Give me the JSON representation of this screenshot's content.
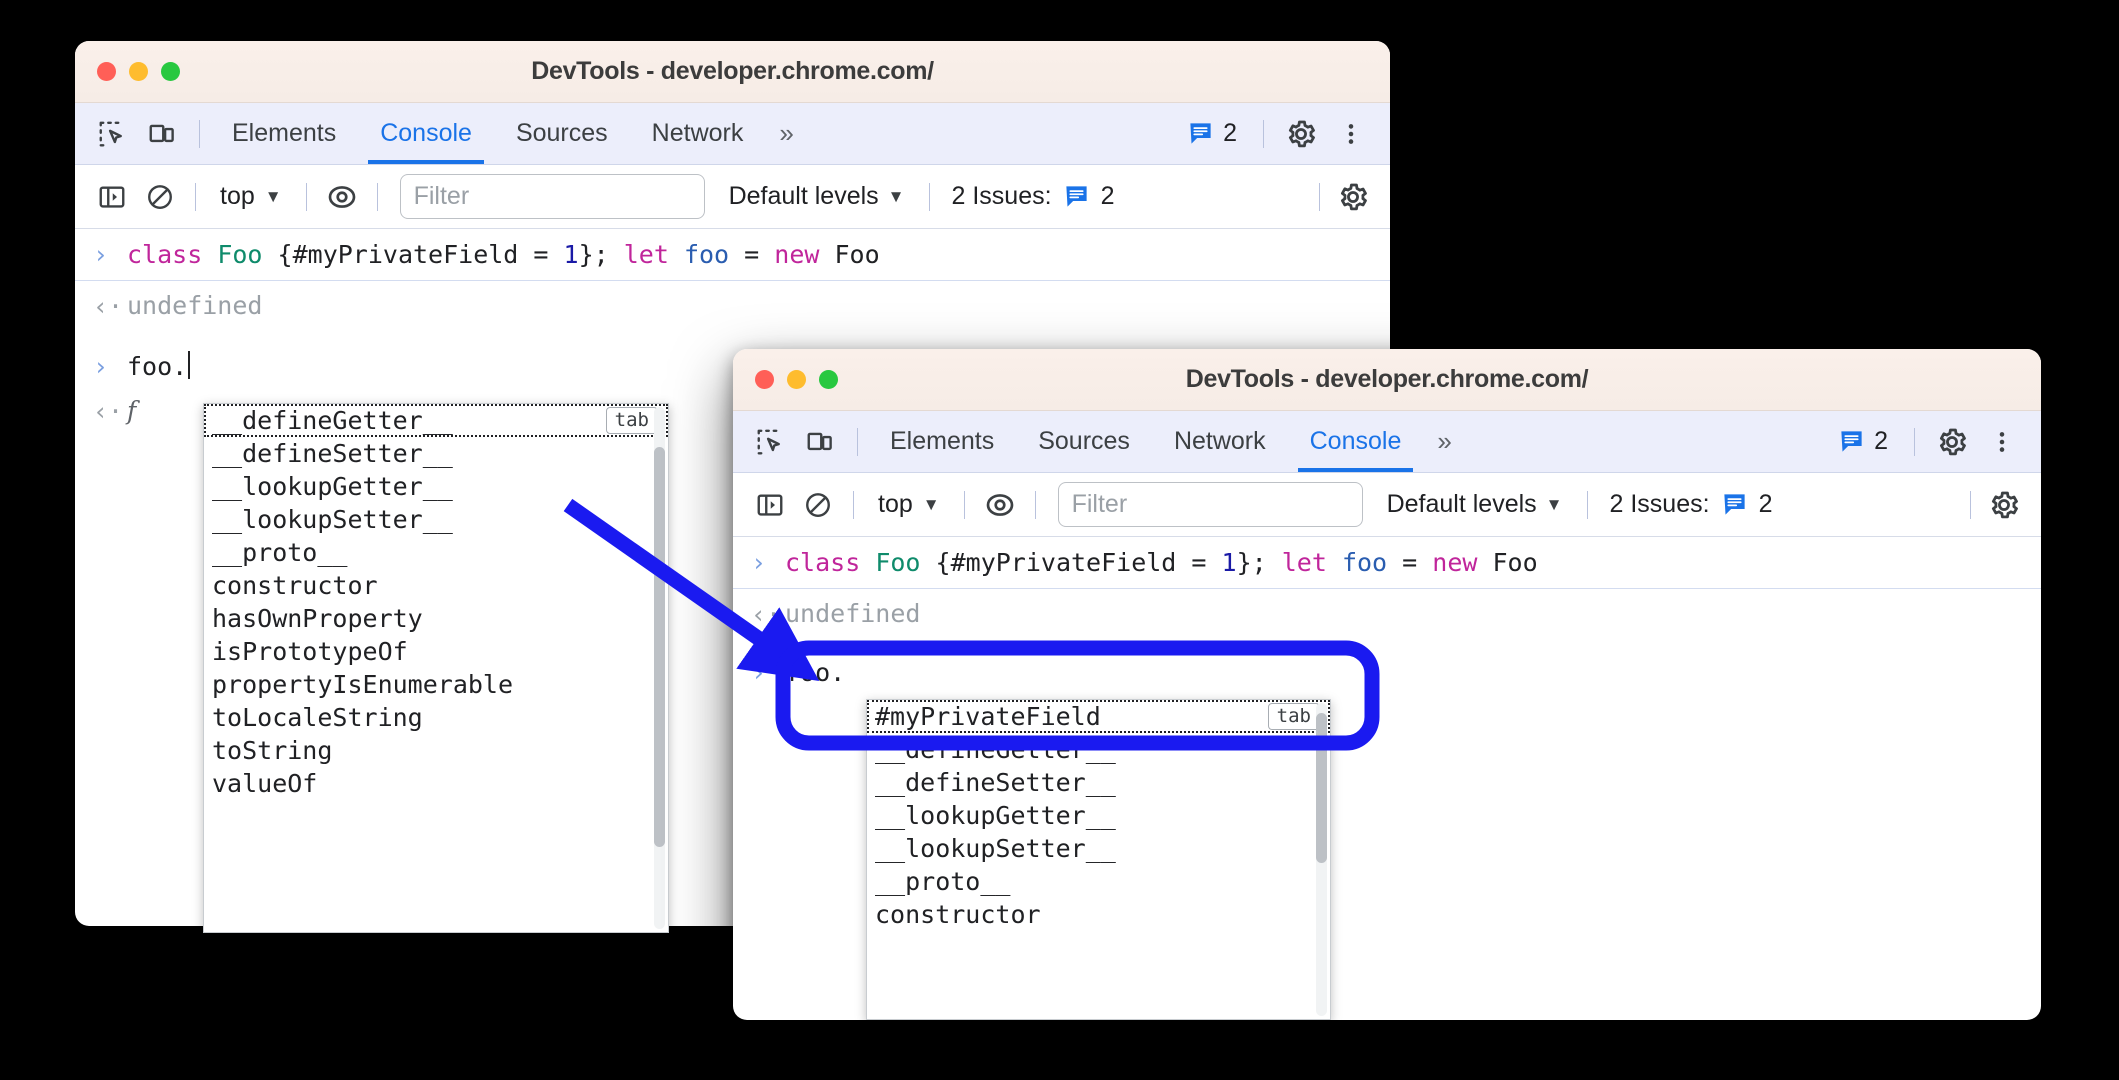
{
  "windows": [
    {
      "id": "back",
      "title": "DevTools - developer.chrome.com/",
      "traffic": [
        "close-red",
        "minimize-yellow",
        "zoom-green"
      ],
      "tabs": [
        {
          "label": "Elements",
          "active": false
        },
        {
          "label": "Console",
          "active": true
        },
        {
          "label": "Sources",
          "active": false
        },
        {
          "label": "Network",
          "active": false
        }
      ],
      "more_tabs_glyph": "»",
      "issues_badge_count": "2",
      "toolbar": {
        "context": "top",
        "filter_placeholder": "Filter",
        "levels": "Default levels",
        "issues_label": "2 Issues:",
        "issues_count": "2"
      },
      "console": {
        "command": [
          {
            "t": "class",
            "c": "kw"
          },
          {
            "t": " ",
            "c": "plain"
          },
          {
            "t": "Foo",
            "c": "cls"
          },
          {
            "t": " {#myPrivateField = ",
            "c": "plain"
          },
          {
            "t": "1",
            "c": "num"
          },
          {
            "t": "}; ",
            "c": "plain"
          },
          {
            "t": "let",
            "c": "kw"
          },
          {
            "t": " ",
            "c": "plain"
          },
          {
            "t": "foo",
            "c": "var"
          },
          {
            "t": " = ",
            "c": "plain"
          },
          {
            "t": "new",
            "c": "kw"
          },
          {
            "t": " Foo",
            "c": "plain"
          }
        ],
        "command_plain": "class Foo {#myPrivateField = 1}; let foo = new Foo",
        "result": "undefined",
        "prompt_value": "foo.",
        "result2": "f",
        "in_glyph": "›",
        "out_glyph": "‹·"
      },
      "autocomplete": {
        "selected_index": 0,
        "tab_hint": "tab",
        "items": [
          "__defineGetter__",
          "__defineSetter__",
          "__lookupGetter__",
          "__lookupSetter__",
          "__proto__",
          "constructor",
          "hasOwnProperty",
          "isPrototypeOf",
          "propertyIsEnumerable",
          "toLocaleString",
          "toString",
          "valueOf"
        ]
      }
    },
    {
      "id": "front",
      "title": "DevTools - developer.chrome.com/",
      "traffic": [
        "close-red",
        "minimize-yellow",
        "zoom-green"
      ],
      "tabs": [
        {
          "label": "Elements",
          "active": false
        },
        {
          "label": "Sources",
          "active": false
        },
        {
          "label": "Network",
          "active": false
        },
        {
          "label": "Console",
          "active": true
        }
      ],
      "more_tabs_glyph": "»",
      "issues_badge_count": "2",
      "toolbar": {
        "context": "top",
        "filter_placeholder": "Filter",
        "levels": "Default levels",
        "issues_label": "2 Issues:",
        "issues_count": "2"
      },
      "console": {
        "command": [
          {
            "t": "class",
            "c": "kw"
          },
          {
            "t": " ",
            "c": "plain"
          },
          {
            "t": "Foo",
            "c": "cls"
          },
          {
            "t": " {#myPrivateField = ",
            "c": "plain"
          },
          {
            "t": "1",
            "c": "num"
          },
          {
            "t": "}; ",
            "c": "plain"
          },
          {
            "t": "let",
            "c": "kw"
          },
          {
            "t": " ",
            "c": "plain"
          },
          {
            "t": "foo",
            "c": "var"
          },
          {
            "t": " = ",
            "c": "plain"
          },
          {
            "t": "new",
            "c": "kw"
          },
          {
            "t": " Foo",
            "c": "plain"
          }
        ],
        "command_plain": "class Foo {#myPrivateField = 1}; let foo = new Foo",
        "result": "undefined",
        "prompt_value": "foo.",
        "in_glyph": "›",
        "out_glyph": "‹·"
      },
      "autocomplete": {
        "selected_index": 0,
        "tab_hint": "tab",
        "items": [
          "#myPrivateField",
          "__defineGetter__",
          "__defineSetter__",
          "__lookupGetter__",
          "__lookupSetter__",
          "__proto__",
          "constructor"
        ]
      }
    }
  ],
  "annotations": {
    "highlight_color": "#1a1af0",
    "arrow_color": "#1a1af0",
    "highlight_target": "foo. prompt with #myPrivateField suggestion",
    "arrow_from": "first-window-autocomplete",
    "arrow_to": "second-window-prompt"
  },
  "colors": {
    "accent_blue": "#1a73e8",
    "issue_badge_blue": "#1a73e8",
    "keyword_magenta": "#c0259b",
    "class_green": "#0f8b6b",
    "number_blue": "#1a1aa6",
    "annotation_blue": "#1a1af0",
    "titlebar_bg": "#faf0ea",
    "tabbar_bg": "#eceefb",
    "page_bg": "#000000"
  },
  "icons": {
    "inspect": "inspect-element-icon",
    "device": "device-toolbar-icon",
    "sidebar": "console-sidebar-icon",
    "clear": "clear-console-icon",
    "eye": "live-expression-icon",
    "gear": "settings-gear-icon",
    "kebab": "more-options-icon",
    "issues": "issues-speech-bubble-icon"
  }
}
